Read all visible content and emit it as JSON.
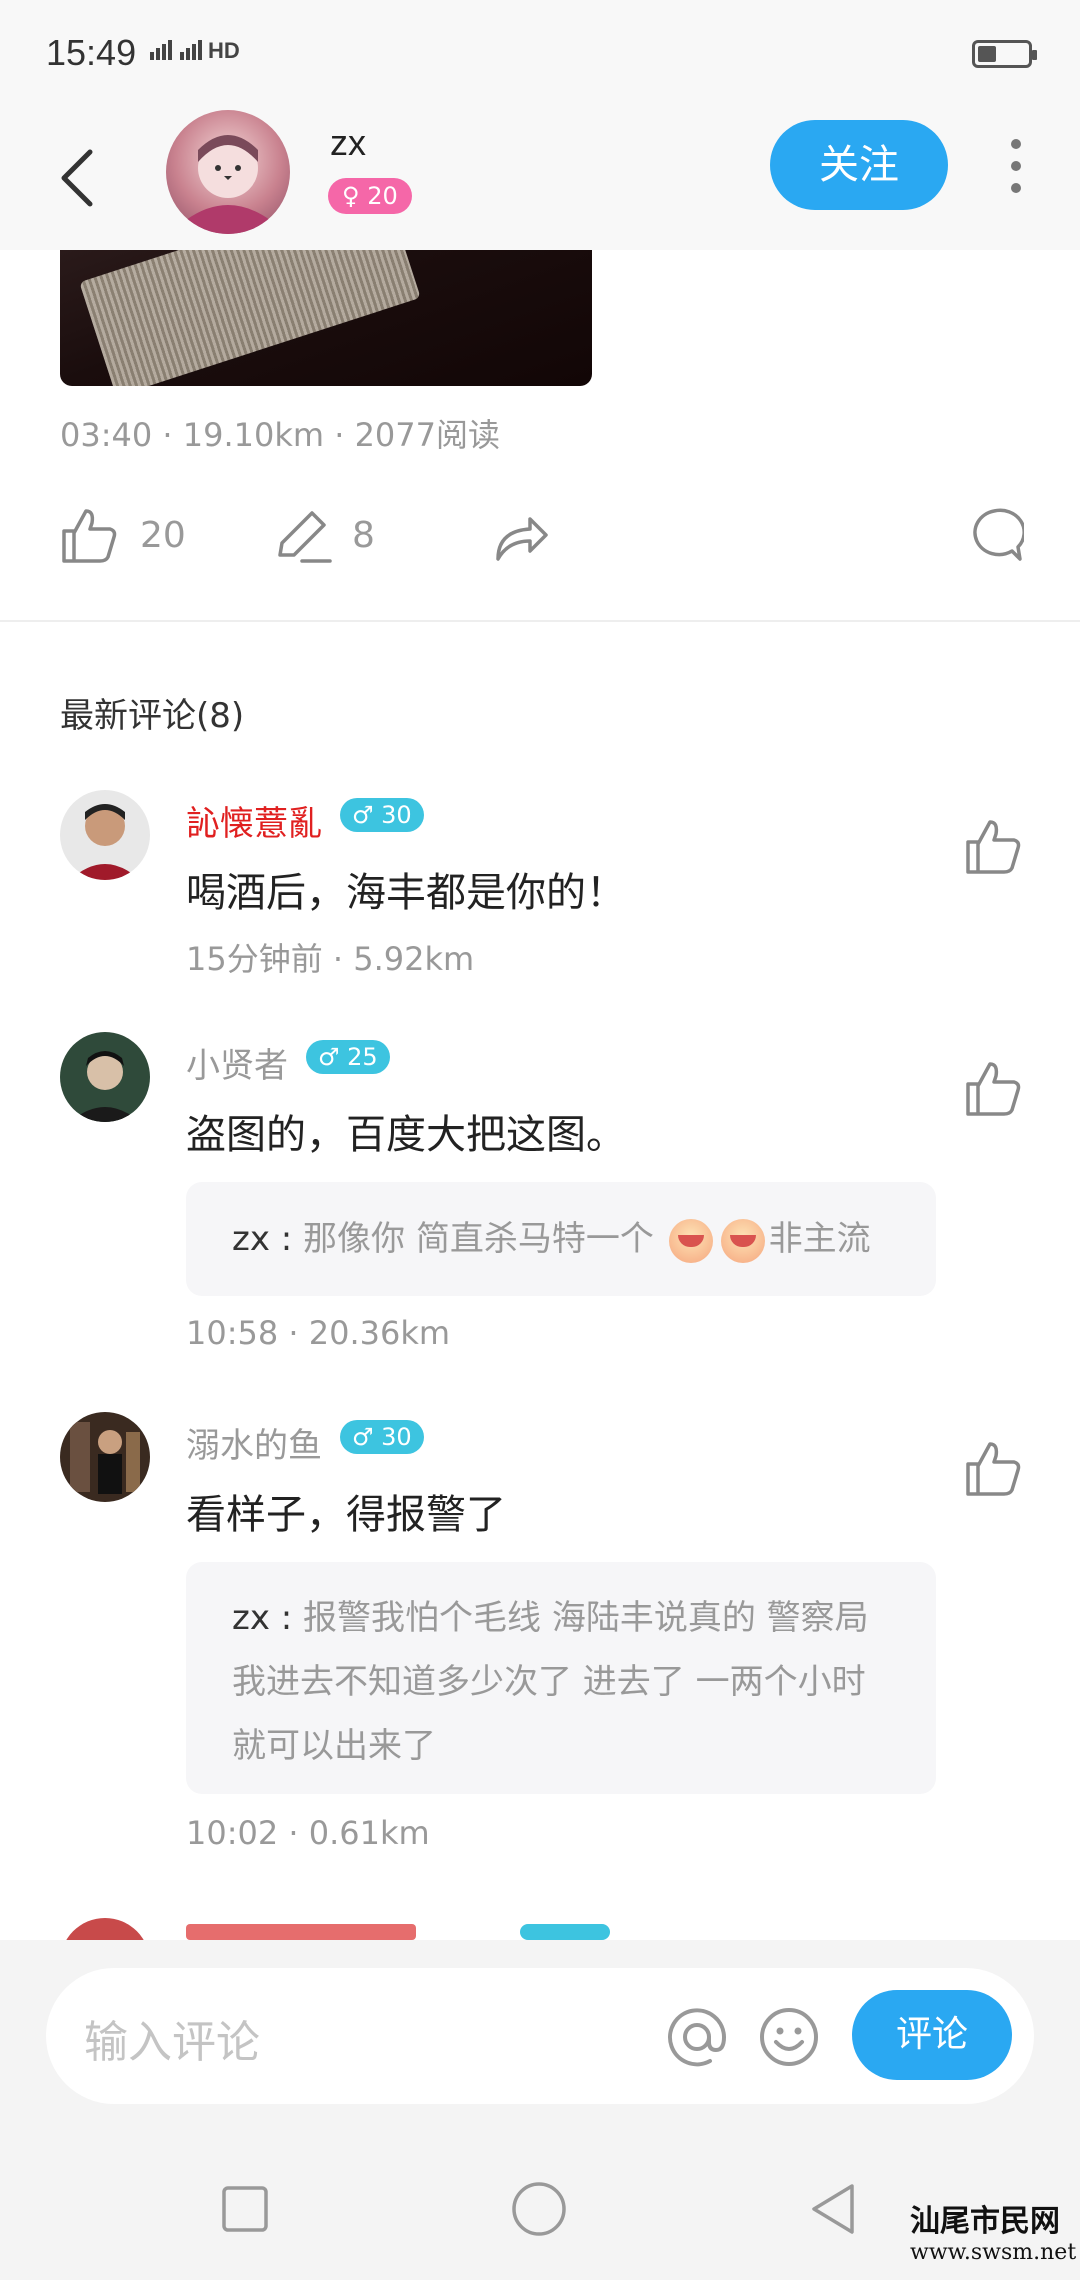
{
  "status_bar": {
    "time": "15:49",
    "network": "4G 2G HD"
  },
  "header": {
    "username": "zx",
    "level": "20",
    "follow_label": "关注"
  },
  "post": {
    "meta": "03:40 · 19.10km · 2077阅读",
    "likes": "20",
    "comments": "8"
  },
  "comments_section": {
    "title": "最新评论(8)"
  },
  "comments": [
    {
      "name": "訫懐薏亂",
      "name_color": "#e02020",
      "level": "30",
      "text": "喝酒后，海丰都是你的！",
      "meta": "15分钟前 · 5.92km"
    },
    {
      "name": "小贤者",
      "name_color": "#999999",
      "level": "25",
      "text": "盗图的，百度大把这图。",
      "reply_user": "zx",
      "reply_sep": " : ",
      "reply_text_a": "那像你 简直杀马特一个",
      "reply_text_b": "非主流",
      "meta": "10:58 · 20.36km"
    },
    {
      "name": "溺水的鱼",
      "name_color": "#999999",
      "level": "30",
      "text": "看样子，得报警了",
      "reply_user": "zx",
      "reply_sep": " : ",
      "reply_text": "报警我怕个毛线 海陆丰说真的 警察局我进去不知道多少次了 进去了 一两个小时就可以出来了",
      "meta": "10:02 · 0.61km"
    }
  ],
  "input": {
    "placeholder": "输入评论",
    "submit_label": "评论"
  },
  "watermark": {
    "title": "汕尾市民网",
    "url": "www.swsm.net"
  },
  "colors": {
    "accent": "#2aa8f2",
    "badge_male": "#3dc4e0",
    "badge_female": "#f567a8"
  }
}
